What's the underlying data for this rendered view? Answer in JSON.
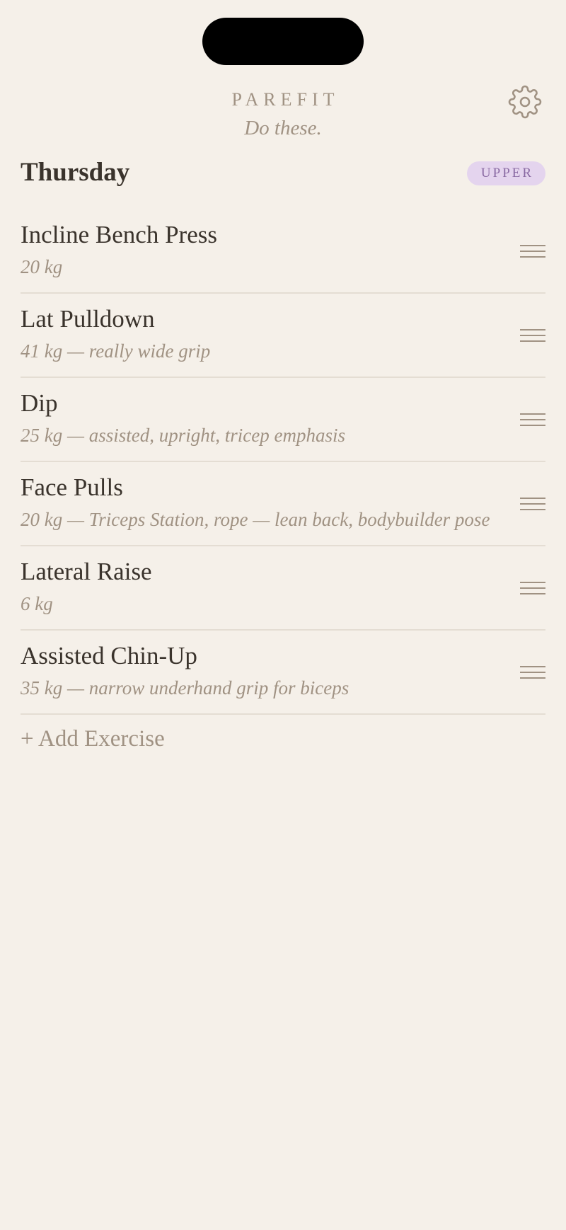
{
  "app": {
    "brand": "PAREFIT",
    "tagline": "Do these."
  },
  "header": {
    "day": "Thursday",
    "badge": "UPPER",
    "settings_icon": "gear-icon"
  },
  "colors": {
    "background": "#f5f0e9",
    "text_primary": "#3a332c",
    "text_muted": "#a09283",
    "badge_bg": "#e4d4ee",
    "badge_text": "#8a6aa3"
  },
  "exercises": [
    {
      "name": "Incline Bench Press",
      "detail": "20 kg"
    },
    {
      "name": "Lat Pulldown",
      "detail": "41 kg — really wide grip"
    },
    {
      "name": "Dip",
      "detail": "25 kg — assisted, upright, tricep emphasis"
    },
    {
      "name": "Face Pulls",
      "detail": "20 kg — Triceps Station, rope — lean back, bodybuilder pose"
    },
    {
      "name": "Lateral Raise",
      "detail": "6 kg"
    },
    {
      "name": "Assisted Chin-Up",
      "detail": "35 kg — narrow underhand grip for biceps"
    }
  ],
  "actions": {
    "add_exercise": "+ Add Exercise"
  }
}
